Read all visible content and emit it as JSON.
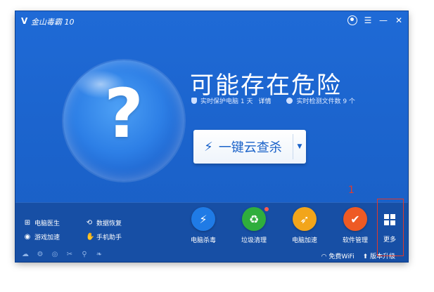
{
  "app": {
    "logo_glyph": "V",
    "title": "金山毒霸 10"
  },
  "window_controls": {
    "user_icon": "user-icon",
    "menu_glyph": "☰",
    "minimize_glyph": "—",
    "close_glyph": "✕"
  },
  "status": {
    "orb_mark": "?",
    "headline": "可能存在危险",
    "protect_text": "实时保护电脑 1 天",
    "details_link": "详情",
    "files_text": "实时检测文件数 9 个"
  },
  "scan": {
    "bolt_glyph": "⚡",
    "label": "一键云查杀",
    "dropdown_glyph": "▼"
  },
  "annotation": {
    "number": "1"
  },
  "quick_tools": [
    {
      "label": "电脑医生",
      "icon": "medkit-icon",
      "glyph": "⊞"
    },
    {
      "label": "数据恢复",
      "icon": "restore-icon",
      "glyph": "⟲"
    },
    {
      "label": "游戏加速",
      "icon": "gamepad-icon",
      "glyph": "◉"
    },
    {
      "label": "手机助手",
      "icon": "phone-hand-icon",
      "glyph": "✋"
    }
  ],
  "features": [
    {
      "label": "电脑杀毒",
      "icon": "bolt-icon",
      "glyph": "⚡",
      "color": "#1f7be6"
    },
    {
      "label": "垃圾清理",
      "icon": "trash-icon",
      "glyph": "♻",
      "color": "#2fae3d"
    },
    {
      "label": "电脑加速",
      "icon": "rocket-icon",
      "glyph": "➶",
      "color": "#f2a51b"
    },
    {
      "label": "软件管理",
      "icon": "software-icon",
      "glyph": "✔",
      "color": "#ee5a24"
    },
    {
      "label": "更多",
      "icon": "grid-icon"
    }
  ],
  "statusbar": {
    "left_icons": [
      "cloud-icon",
      "gear-icon",
      "target-icon",
      "tools-icon",
      "usb-icon",
      "leaf-icon"
    ],
    "left_glyphs": [
      "☁",
      "⚙",
      "◎",
      "✂",
      "⚲",
      "❧"
    ],
    "wifi_label": "免费WiFi",
    "upgrade_label": "版本升级"
  }
}
